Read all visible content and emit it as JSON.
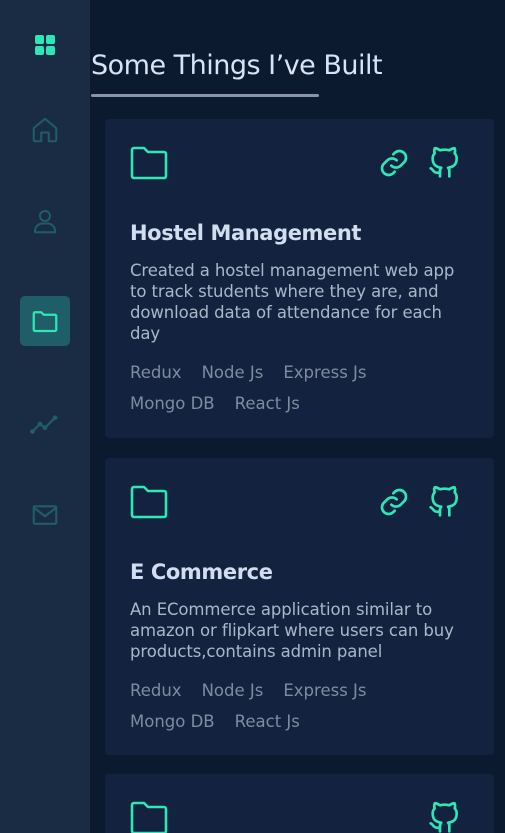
{
  "sidebar": {
    "logo_icon": "grid-icon",
    "items": [
      {
        "name": "home",
        "icon": "home-icon",
        "active": false
      },
      {
        "name": "about",
        "icon": "user-icon",
        "active": false
      },
      {
        "name": "projects",
        "icon": "folder-icon",
        "active": true
      },
      {
        "name": "experience",
        "icon": "chart-line-icon",
        "active": false
      },
      {
        "name": "contact",
        "icon": "mail-icon",
        "active": false
      }
    ]
  },
  "section": {
    "title": "Some Things I’ve Built"
  },
  "projects": [
    {
      "title": "Hostel Management",
      "description": "Created a hostel management web app to track students where they are, and download data of attendance for each day",
      "tags": [
        "Redux",
        "Node Js",
        "Express Js",
        "Mongo DB",
        "React Js"
      ],
      "has_link": true,
      "has_github": true
    },
    {
      "title": "E Commerce",
      "description": "An ECommerce application similar to amazon or flipkart where users can buy products,contains admin panel",
      "tags": [
        "Redux",
        "Node Js",
        "Express Js",
        "Mongo DB",
        "React Js"
      ],
      "has_link": true,
      "has_github": true
    },
    {
      "title": "",
      "description": "",
      "tags": [],
      "has_link": false,
      "has_github": true
    }
  ],
  "colors": {
    "accent": "#2ee6b6",
    "background": "#0b1a2f",
    "sidebar": "#1a2c44",
    "card": "#13233f",
    "active_nav": "#1f5d68"
  }
}
